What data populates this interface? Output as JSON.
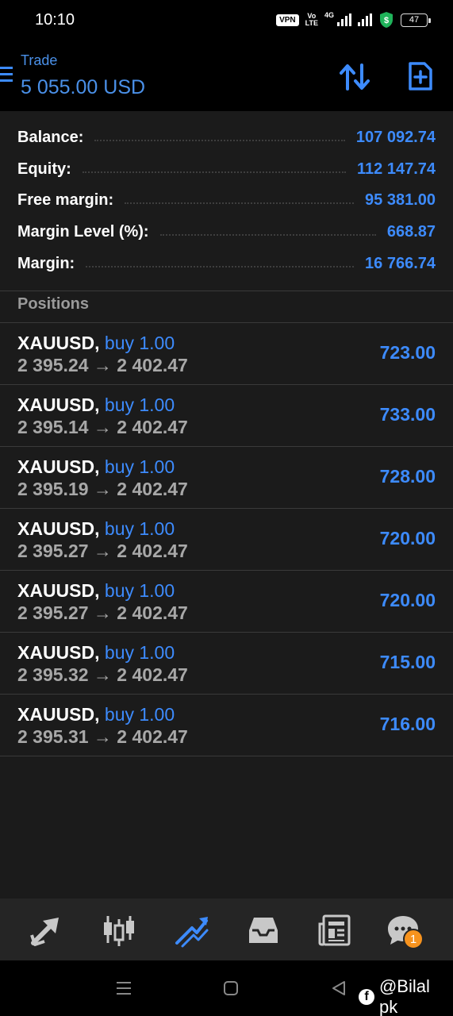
{
  "status_bar": {
    "time": "10:10",
    "vpn": "VPN",
    "volte_top": "Vo",
    "volte_bottom": "LTE",
    "network": "4G",
    "battery": "47"
  },
  "header": {
    "subtitle": "Trade",
    "title": "5 055.00 USD"
  },
  "summary": [
    {
      "label": "Balance:",
      "value": "107 092.74"
    },
    {
      "label": "Equity:",
      "value": "112 147.74"
    },
    {
      "label": "Free margin:",
      "value": "95 381.00"
    },
    {
      "label": "Margin Level (%):",
      "value": "668.87"
    },
    {
      "label": "Margin:",
      "value": "16 766.74"
    }
  ],
  "positions_title": "Positions",
  "positions": [
    {
      "symbol": "XAUUSD,",
      "direction": "buy 1.00",
      "prices": "2 395.24 → 2 402.47",
      "profit": "723.00"
    },
    {
      "symbol": "XAUUSD,",
      "direction": "buy 1.00",
      "prices": "2 395.14 → 2 402.47",
      "profit": "733.00"
    },
    {
      "symbol": "XAUUSD,",
      "direction": "buy 1.00",
      "prices": "2 395.19 → 2 402.47",
      "profit": "728.00"
    },
    {
      "symbol": "XAUUSD,",
      "direction": "buy 1.00",
      "prices": "2 395.27 → 2 402.47",
      "profit": "720.00"
    },
    {
      "symbol": "XAUUSD,",
      "direction": "buy 1.00",
      "prices": "2 395.27 → 2 402.47",
      "profit": "720.00"
    },
    {
      "symbol": "XAUUSD,",
      "direction": "buy 1.00",
      "prices": "2 395.32 → 2 402.47",
      "profit": "715.00"
    },
    {
      "symbol": "XAUUSD,",
      "direction": "buy 1.00",
      "prices": "2 395.31 → 2 402.47",
      "profit": "716.00"
    }
  ],
  "bottom_nav": {
    "items": [
      "quotes-icon",
      "chart-icon",
      "trade-icon",
      "history-icon",
      "news-icon",
      "chat-icon"
    ],
    "active": "trade-icon",
    "chat_badge": "1"
  },
  "watermark": {
    "icon": "f",
    "text": "@Bilal pk"
  },
  "colors": {
    "accent": "#3d8bfd",
    "panel": "#1b1b1b",
    "nav": "#252525",
    "badge": "#f7931e",
    "secure_icon": "#1fb35a"
  }
}
